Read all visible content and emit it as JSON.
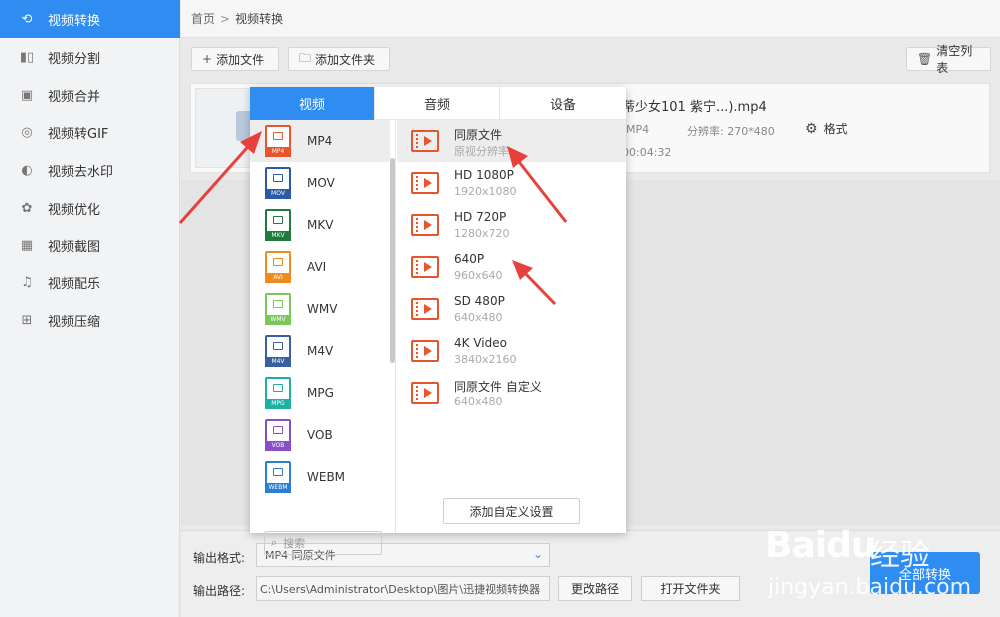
{
  "sidebar": {
    "items": [
      {
        "label": "视频转换",
        "icon": "convert-icon",
        "active": true
      },
      {
        "label": "视频分割",
        "icon": "split-icon"
      },
      {
        "label": "视频合并",
        "icon": "merge-icon"
      },
      {
        "label": "视频转GIF",
        "icon": "gif-icon"
      },
      {
        "label": "视频去水印",
        "icon": "watermark-icon"
      },
      {
        "label": "视频优化",
        "icon": "optimize-icon"
      },
      {
        "label": "视频截图",
        "icon": "screenshot-icon"
      },
      {
        "label": "视频配乐",
        "icon": "music-icon"
      },
      {
        "label": "视频压缩",
        "icon": "compress-icon"
      }
    ]
  },
  "breadcrumb": {
    "home": "首页",
    "separator": ">",
    "current": "视频转换"
  },
  "toolbar": {
    "add_file": "添加文件",
    "add_folder": "添加文件夹",
    "clear_list": "清空列表"
  },
  "file": {
    "name": "蒂少女101 紫宁...).mp4",
    "format": "MP4",
    "resolution": "分辨率: 270*480",
    "duration": "00:04:32",
    "format_button": "格式"
  },
  "popup": {
    "tabs": [
      {
        "label": "视频",
        "active": true
      },
      {
        "label": "音频"
      },
      {
        "label": "设备"
      }
    ],
    "formats": [
      {
        "label": "MP4",
        "tag": "MP4",
        "color": "#e8542c",
        "active": true
      },
      {
        "label": "MOV",
        "tag": "MOV",
        "color": "#2b5aa8"
      },
      {
        "label": "MKV",
        "tag": "MKV",
        "color": "#1f7a3e"
      },
      {
        "label": "AVI",
        "tag": "AVI",
        "color": "#f08a1c"
      },
      {
        "label": "WMV",
        "tag": "WMV",
        "color": "#7cc65a"
      },
      {
        "label": "M4V",
        "tag": "M4V",
        "color": "#3a5fa0"
      },
      {
        "label": "MPG",
        "tag": "MPG",
        "color": "#1fb0a4"
      },
      {
        "label": "VOB",
        "tag": "VOB",
        "color": "#8a4fc8"
      },
      {
        "label": "WEBM",
        "tag": "WEBM",
        "color": "#2a7fd4"
      }
    ],
    "presets": [
      {
        "name": "同原文件",
        "res": "原视分辨率",
        "active": true
      },
      {
        "name": "HD 1080P",
        "res": "1920x1080"
      },
      {
        "name": "HD 720P",
        "res": "1280x720"
      },
      {
        "name": "640P",
        "res": "960x640"
      },
      {
        "name": "SD 480P",
        "res": "640x480"
      },
      {
        "name": "4K Video",
        "res": "3840x2160"
      },
      {
        "name": "同原文件 自定义",
        "res": "640x480"
      }
    ],
    "search_placeholder": "搜索",
    "add_custom": "添加自定义设置"
  },
  "bottom": {
    "output_format_label": "输出格式:",
    "output_format_value": "MP4  同原文件",
    "output_path_label": "输出路径:",
    "output_path_value": "C:\\Users\\Administrator\\Desktop\\图片\\迅捷视频转换器",
    "change_path": "更改路径",
    "open_folder": "打开文件夹",
    "convert_all": "全部转换"
  },
  "watermark": {
    "brand": "Baidu",
    "brand2": "经验",
    "url": "jingyan.baidu.com"
  },
  "colors": {
    "accent": "#2f8cf0",
    "arrow": "#e8413c",
    "preset_icon": "#e8542c"
  }
}
